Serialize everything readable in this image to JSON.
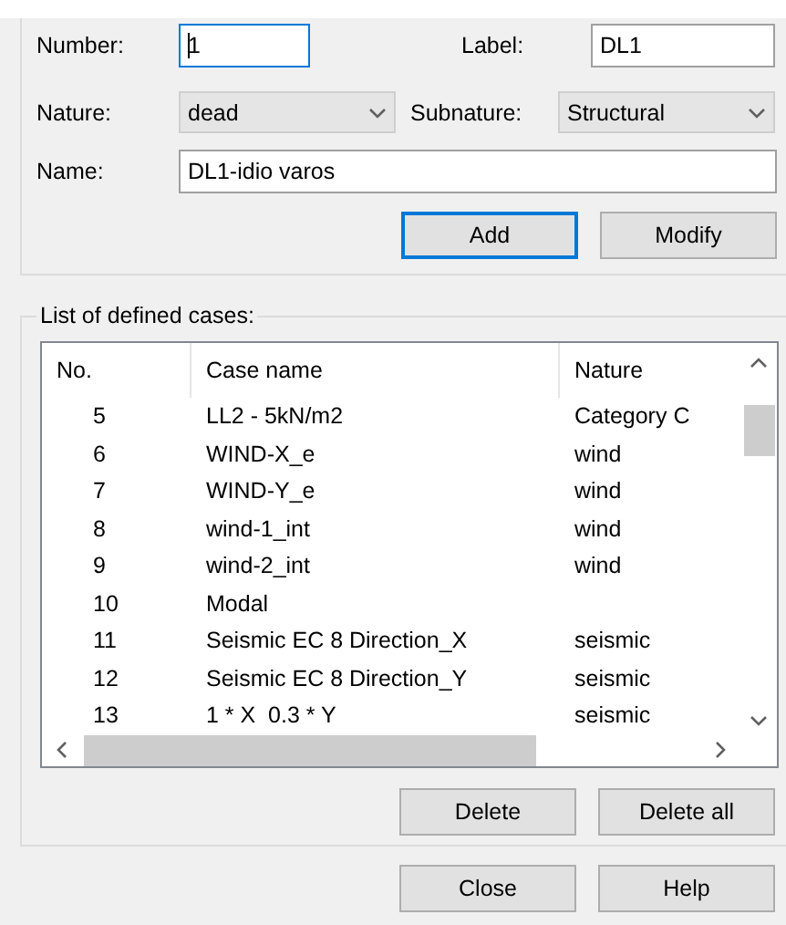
{
  "form": {
    "number": {
      "label": "Number:",
      "value": "1",
      "focused": true
    },
    "label": {
      "label": "Label:",
      "value": "DL1",
      "focused": false
    },
    "nature": {
      "label": "Nature:",
      "value": "dead"
    },
    "subnature": {
      "label": "Subnature:",
      "value": "Structural"
    },
    "name": {
      "label": "Name:",
      "value": "DL1-idio varos",
      "focused": false
    }
  },
  "form_buttons": [
    {
      "label": "Add",
      "focused": true
    },
    {
      "label": "Modify",
      "focused": false
    }
  ],
  "cases": {
    "title": "List of defined cases:",
    "columns": [
      "No.",
      "Case name",
      "Nature"
    ],
    "rows": [
      {
        "no": "5",
        "name": "LL2 - 5kN/m2",
        "nature": "Category C"
      },
      {
        "no": "6",
        "name": "WIND-X_e",
        "nature": "wind"
      },
      {
        "no": "7",
        "name": "WIND-Y_e",
        "nature": "wind"
      },
      {
        "no": "8",
        "name": "wind-1_int",
        "nature": "wind"
      },
      {
        "no": "9",
        "name": "wind-2_int",
        "nature": "wind"
      },
      {
        "no": "10",
        "name": "Modal",
        "nature": ""
      },
      {
        "no": "11",
        "name": "Seismic EC 8 Direction_X",
        "nature": "seismic"
      },
      {
        "no": "12",
        "name": "Seismic EC 8 Direction_Y",
        "nature": "seismic"
      },
      {
        "no": "13",
        "name": "1 * X  0.3 * Y",
        "nature": "seismic"
      }
    ]
  },
  "list_buttons": [
    {
      "label": "Delete",
      "focused": false
    },
    {
      "label": "Delete all",
      "focused": false
    }
  ],
  "dialog_buttons": [
    {
      "label": "Close",
      "focused": false
    },
    {
      "label": "Help",
      "focused": false
    }
  ]
}
